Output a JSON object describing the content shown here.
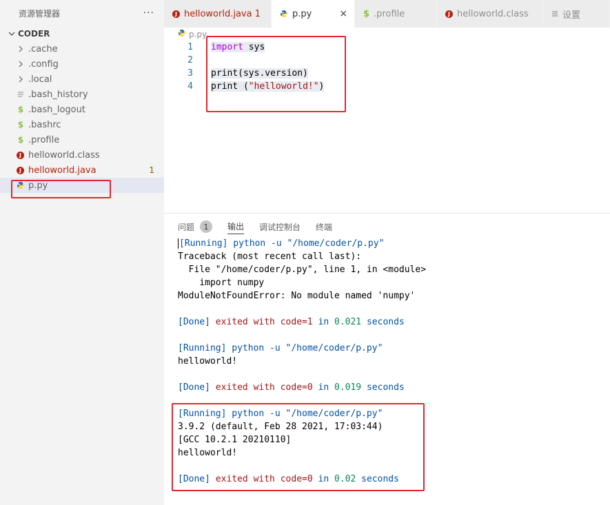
{
  "sidebar": {
    "title": "资源管理器",
    "more": "···",
    "folder": "CODER",
    "items": [
      {
        "label": ".cache",
        "icon": "chevron-right-icon",
        "badge": ""
      },
      {
        "label": ".config",
        "icon": "chevron-right-icon",
        "badge": ""
      },
      {
        "label": ".local",
        "icon": "chevron-right-icon",
        "badge": ""
      },
      {
        "label": ".bash_history",
        "icon": "file-lines-icon",
        "badge": ""
      },
      {
        "label": ".bash_logout",
        "icon": "dollar-icon",
        "badge": ""
      },
      {
        "label": ".bashrc",
        "icon": "dollar-icon",
        "badge": ""
      },
      {
        "label": ".profile",
        "icon": "dollar-icon",
        "badge": ""
      },
      {
        "label": "helloworld.class",
        "icon": "java-icon",
        "badge": ""
      },
      {
        "label": "helloworld.java",
        "icon": "java-icon",
        "badge": "1"
      },
      {
        "label": "p.py",
        "icon": "python-icon",
        "badge": ""
      }
    ]
  },
  "tabs": [
    {
      "label": "helloworld.java",
      "count": "1"
    },
    {
      "label": "p.py",
      "close": "×"
    },
    {
      "label": ".profile"
    },
    {
      "label": "helloworld.class"
    },
    {
      "label": "设置"
    }
  ],
  "breadcrumb": "p.py",
  "editor": {
    "lines": [
      {
        "n": "1",
        "kw": "import",
        "rest": " sys"
      },
      {
        "n": "2",
        "kw": "",
        "rest": ""
      },
      {
        "n": "3",
        "kw": "",
        "rest": "print(sys.version)"
      },
      {
        "n": "4",
        "kw": "",
        "rest": "print (",
        "str": "\"helloworld!\"",
        "end": ")"
      }
    ]
  },
  "panel": {
    "tabs": [
      "问题",
      "输出",
      "调试控制台",
      "终端"
    ],
    "problems_count": "1",
    "output": {
      "run1": "[Running] python -u \"/home/coder/p.py\"",
      "tb1": "Traceback (most recent call last):",
      "tb2": "  File \"/home/coder/p.py\", line 1, in <module>",
      "tb3": "    import numpy",
      "tb4": "ModuleNotFoundError: No module named 'numpy'",
      "done1": {
        "tag": "[Done]",
        "a": " exited with ",
        "code": "code=1",
        "b": " in ",
        "t": "0.021",
        "c": " seconds"
      },
      "run2": "[Running] python -u \"/home/coder/p.py\"",
      "out2": "helloworld!",
      "done2": {
        "tag": "[Done]",
        "a": " exited with ",
        "code": "code=0",
        "b": " in ",
        "t": "0.019",
        "c": " seconds"
      },
      "run3": "[Running] python -u \"/home/coder/p.py\"",
      "out3a": "3.9.2 (default, Feb 28 2021, 17:03:44)",
      "out3b": "[GCC 10.2.1 20210110]",
      "out3c": "helloworld!",
      "done3": {
        "tag": "[Done]",
        "a": " exited with ",
        "code": "code=0",
        "b": " in ",
        "t": "0.02",
        "c": " seconds"
      }
    }
  },
  "colors": {
    "highlight_box": "#e3262e",
    "accent_blue": "#0451a5"
  }
}
